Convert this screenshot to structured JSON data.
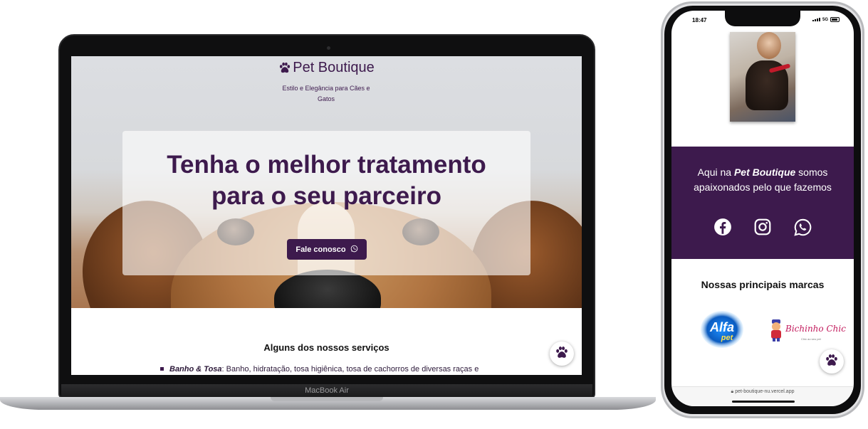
{
  "laptop": {
    "model_label": "MacBook Air",
    "site": {
      "brand_name": "Pet Boutique",
      "tagline": "Estilo e Elegância para Cães e Gatos",
      "hero_title_line1": "Tenha o melhor tratamento",
      "hero_title_line2": "para o seu parceiro",
      "cta_label": "Fale conosco",
      "services_title": "Alguns dos nossos serviços",
      "service_first_name": "Banho & Tosa",
      "service_first_desc": ": Banho, hidratação, tosa higiênica, tosa de cachorros de diversas raças e"
    }
  },
  "phone": {
    "status_time": "18:47",
    "network": "5G",
    "about_prefix": "Aqui na ",
    "about_brand": "Pet Boutique",
    "about_suffix": " somos apaixonados pelo que fazemos",
    "socials": [
      "facebook-icon",
      "instagram-icon",
      "whatsapp-icon"
    ],
    "brands_title": "Nossas principais marcas",
    "brand_logos": {
      "alfa_line1": "Alfa",
      "alfa_line2": "pet",
      "bichinho": "Bichinho Chic",
      "bichinho_sub": "Chic ao seu pet"
    },
    "url": "pet-boutique-nu.vercel.app"
  },
  "colors": {
    "brand_purple": "#3d1a4d",
    "white": "#ffffff"
  }
}
